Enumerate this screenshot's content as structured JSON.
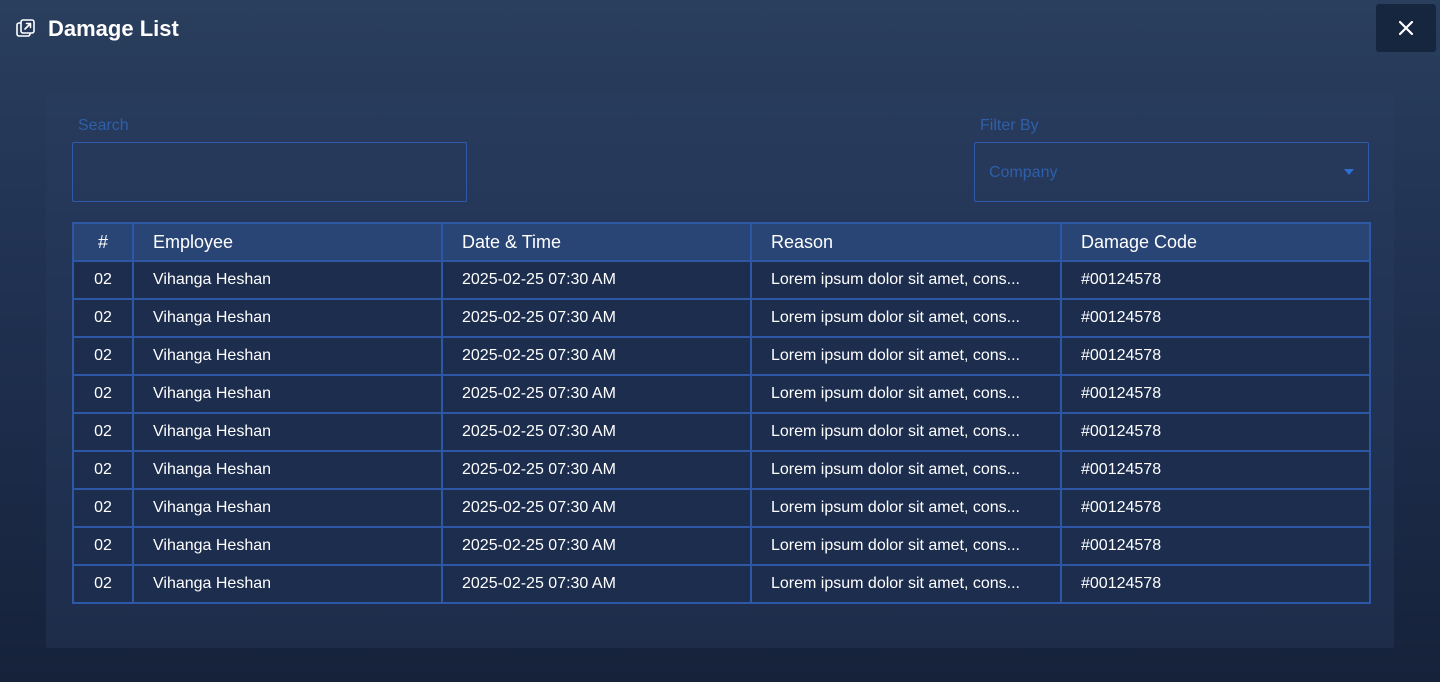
{
  "header": {
    "title": "Damage List",
    "icon": "external-link-icon",
    "close_icon": "close-icon"
  },
  "search": {
    "label": "Search",
    "value": "",
    "placeholder": ""
  },
  "filter": {
    "label": "Filter By",
    "selected": "Company"
  },
  "table": {
    "headers": [
      "#",
      "Employee",
      "Date  & Time",
      "Reason",
      "Damage Code"
    ],
    "rows": [
      {
        "num": "02",
        "employee": "Vihanga Heshan",
        "datetime": "2025-02-25 07:30 AM",
        "reason": "Lorem ipsum dolor sit amet, cons...",
        "code": "#00124578"
      },
      {
        "num": "02",
        "employee": "Vihanga Heshan",
        "datetime": "2025-02-25 07:30 AM",
        "reason": "Lorem ipsum dolor sit amet, cons...",
        "code": "#00124578"
      },
      {
        "num": "02",
        "employee": "Vihanga Heshan",
        "datetime": "2025-02-25 07:30 AM",
        "reason": "Lorem ipsum dolor sit amet, cons...",
        "code": "#00124578"
      },
      {
        "num": "02",
        "employee": "Vihanga Heshan",
        "datetime": "2025-02-25 07:30 AM",
        "reason": "Lorem ipsum dolor sit amet, cons...",
        "code": "#00124578"
      },
      {
        "num": "02",
        "employee": "Vihanga Heshan",
        "datetime": "2025-02-25 07:30 AM",
        "reason": "Lorem ipsum dolor sit amet, cons...",
        "code": "#00124578"
      },
      {
        "num": "02",
        "employee": "Vihanga Heshan",
        "datetime": "2025-02-25 07:30 AM",
        "reason": "Lorem ipsum dolor sit amet, cons...",
        "code": "#00124578"
      },
      {
        "num": "02",
        "employee": "Vihanga Heshan",
        "datetime": "2025-02-25 07:30 AM",
        "reason": "Lorem ipsum dolor sit amet, cons...",
        "code": "#00124578"
      },
      {
        "num": "02",
        "employee": "Vihanga Heshan",
        "datetime": "2025-02-25 07:30 AM",
        "reason": "Lorem ipsum dolor sit amet, cons...",
        "code": "#00124578"
      },
      {
        "num": "02",
        "employee": "Vihanga Heshan",
        "datetime": "2025-02-25 07:30 AM",
        "reason": "Lorem ipsum dolor sit amet, cons...",
        "code": "#00124578"
      }
    ]
  }
}
